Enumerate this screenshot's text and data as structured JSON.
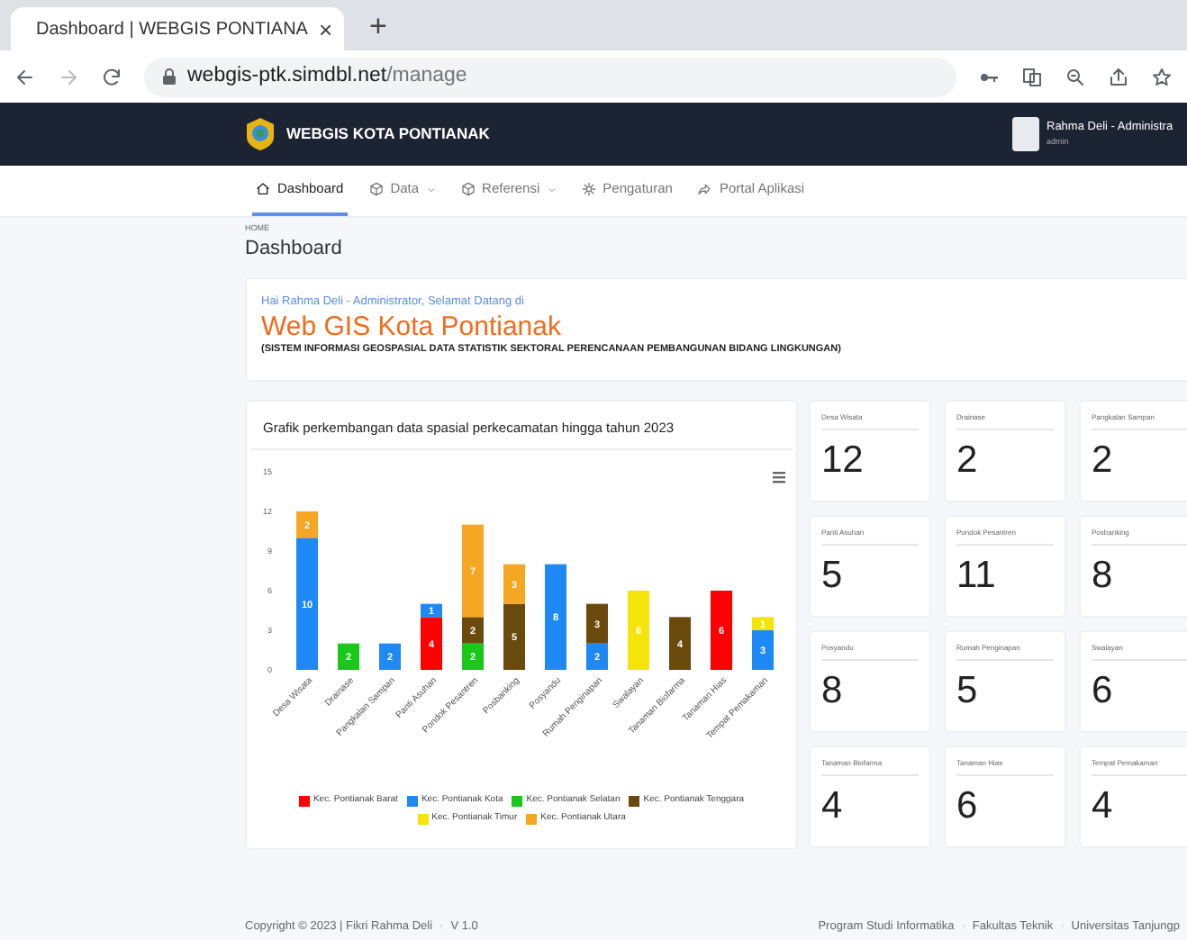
{
  "browser": {
    "tab_title": "Dashboard | WEBGIS PONTIANA",
    "new_tab": "+",
    "close": "×",
    "url_host": "webgis-ptk.simdbl.net",
    "url_path": "/manage"
  },
  "navbar": {
    "brand": "WEBGIS KOTA PONTIANAK",
    "user_name": "Rahma Deli - Administra",
    "user_role": "admin"
  },
  "menu": [
    {
      "label": "Dashboard",
      "selected": true,
      "has_dropdown": false
    },
    {
      "label": "Data",
      "selected": false,
      "has_dropdown": true
    },
    {
      "label": "Referensi",
      "selected": false,
      "has_dropdown": true
    },
    {
      "label": "Pengaturan",
      "selected": false,
      "has_dropdown": false
    },
    {
      "label": "Portal Aplikasi",
      "selected": false,
      "has_dropdown": false
    }
  ],
  "breadcrumb": "HOME",
  "page_title": "Dashboard",
  "welcome": {
    "greeting": "Hai Rahma Deli - Administrator, Selamat Datang di",
    "title": "Web GIS Kota Pontianak",
    "subtitle": "(SISTEM INFORMASI GEOSPASIAL DATA STATISTIK SEKTORAL PERENCANAAN PEMBANGUNAN BIDANG LINGKUNGAN)"
  },
  "chart": {
    "title": "Grafik perkembangan data spasial perkecamatan hingga tahun 2023",
    "chart_data": {
      "type": "bar",
      "stacked": true,
      "data_labels": true,
      "ylim": [
        0,
        15
      ],
      "yticks": [
        0,
        3,
        6,
        9,
        12,
        15
      ],
      "categories": [
        "Desa Wisata",
        "Drainase",
        "Pangkalan Sampan",
        "Panti Asuhan",
        "Pondok Pesantren",
        "Posbanking",
        "Posyandu",
        "Rumah Penginapan",
        "Swalayan",
        "Tanaman Biofarma",
        "Tanaman Hias",
        "Tempat Pemakaman"
      ],
      "series": [
        {
          "name": "Kec. Pontianak Barat",
          "color": "#ff0000",
          "values": [
            null,
            null,
            null,
            4,
            null,
            null,
            null,
            null,
            null,
            null,
            6,
            null
          ]
        },
        {
          "name": "Kec. Pontianak Kota",
          "color": "#1e88f5",
          "values": [
            10,
            null,
            2,
            1,
            null,
            null,
            8,
            2,
            null,
            null,
            null,
            3
          ]
        },
        {
          "name": "Kec. Pontianak Selatan",
          "color": "#19c819",
          "values": [
            null,
            2,
            null,
            null,
            2,
            null,
            null,
            null,
            null,
            null,
            null,
            null
          ]
        },
        {
          "name": "Kec. Pontianak Tenggara",
          "color": "#6b4a0e",
          "values": [
            null,
            null,
            null,
            null,
            2,
            5,
            null,
            3,
            null,
            4,
            null,
            null
          ]
        },
        {
          "name": "Kec. Pontianak Timur",
          "color": "#f5e40a",
          "values": [
            null,
            null,
            null,
            null,
            null,
            null,
            null,
            null,
            6,
            null,
            null,
            1
          ]
        },
        {
          "name": "Kec. Pontianak Utara",
          "color": "#f5a623",
          "values": [
            2,
            null,
            null,
            null,
            7,
            3,
            null,
            null,
            null,
            null,
            null,
            null
          ]
        }
      ]
    }
  },
  "stats": [
    {
      "label": "Desa Wisata",
      "value": "12"
    },
    {
      "label": "Drainase",
      "value": "2"
    },
    {
      "label": "Pangkalan Sampan",
      "value": "2"
    },
    {
      "label": "Panti Asuhan",
      "value": "5"
    },
    {
      "label": "Pondok Pesantren",
      "value": "11"
    },
    {
      "label": "Posbanking",
      "value": "8"
    },
    {
      "label": "Posyandu",
      "value": "8"
    },
    {
      "label": "Rumah Penginapan",
      "value": "5"
    },
    {
      "label": "Swalayan",
      "value": "6"
    },
    {
      "label": "Tanaman Biofarma",
      "value": "4"
    },
    {
      "label": "Tanaman Hias",
      "value": "6"
    },
    {
      "label": "Tempat Pemakaman",
      "value": "4"
    }
  ],
  "footer": {
    "separator": "·",
    "left": [
      "Copyright © 2023 | Fikri Rahma Deli",
      "V 1.0"
    ],
    "right": [
      "Program Studi Informatika",
      "Fakultas Teknik",
      "Universitas Tanjungp"
    ]
  }
}
